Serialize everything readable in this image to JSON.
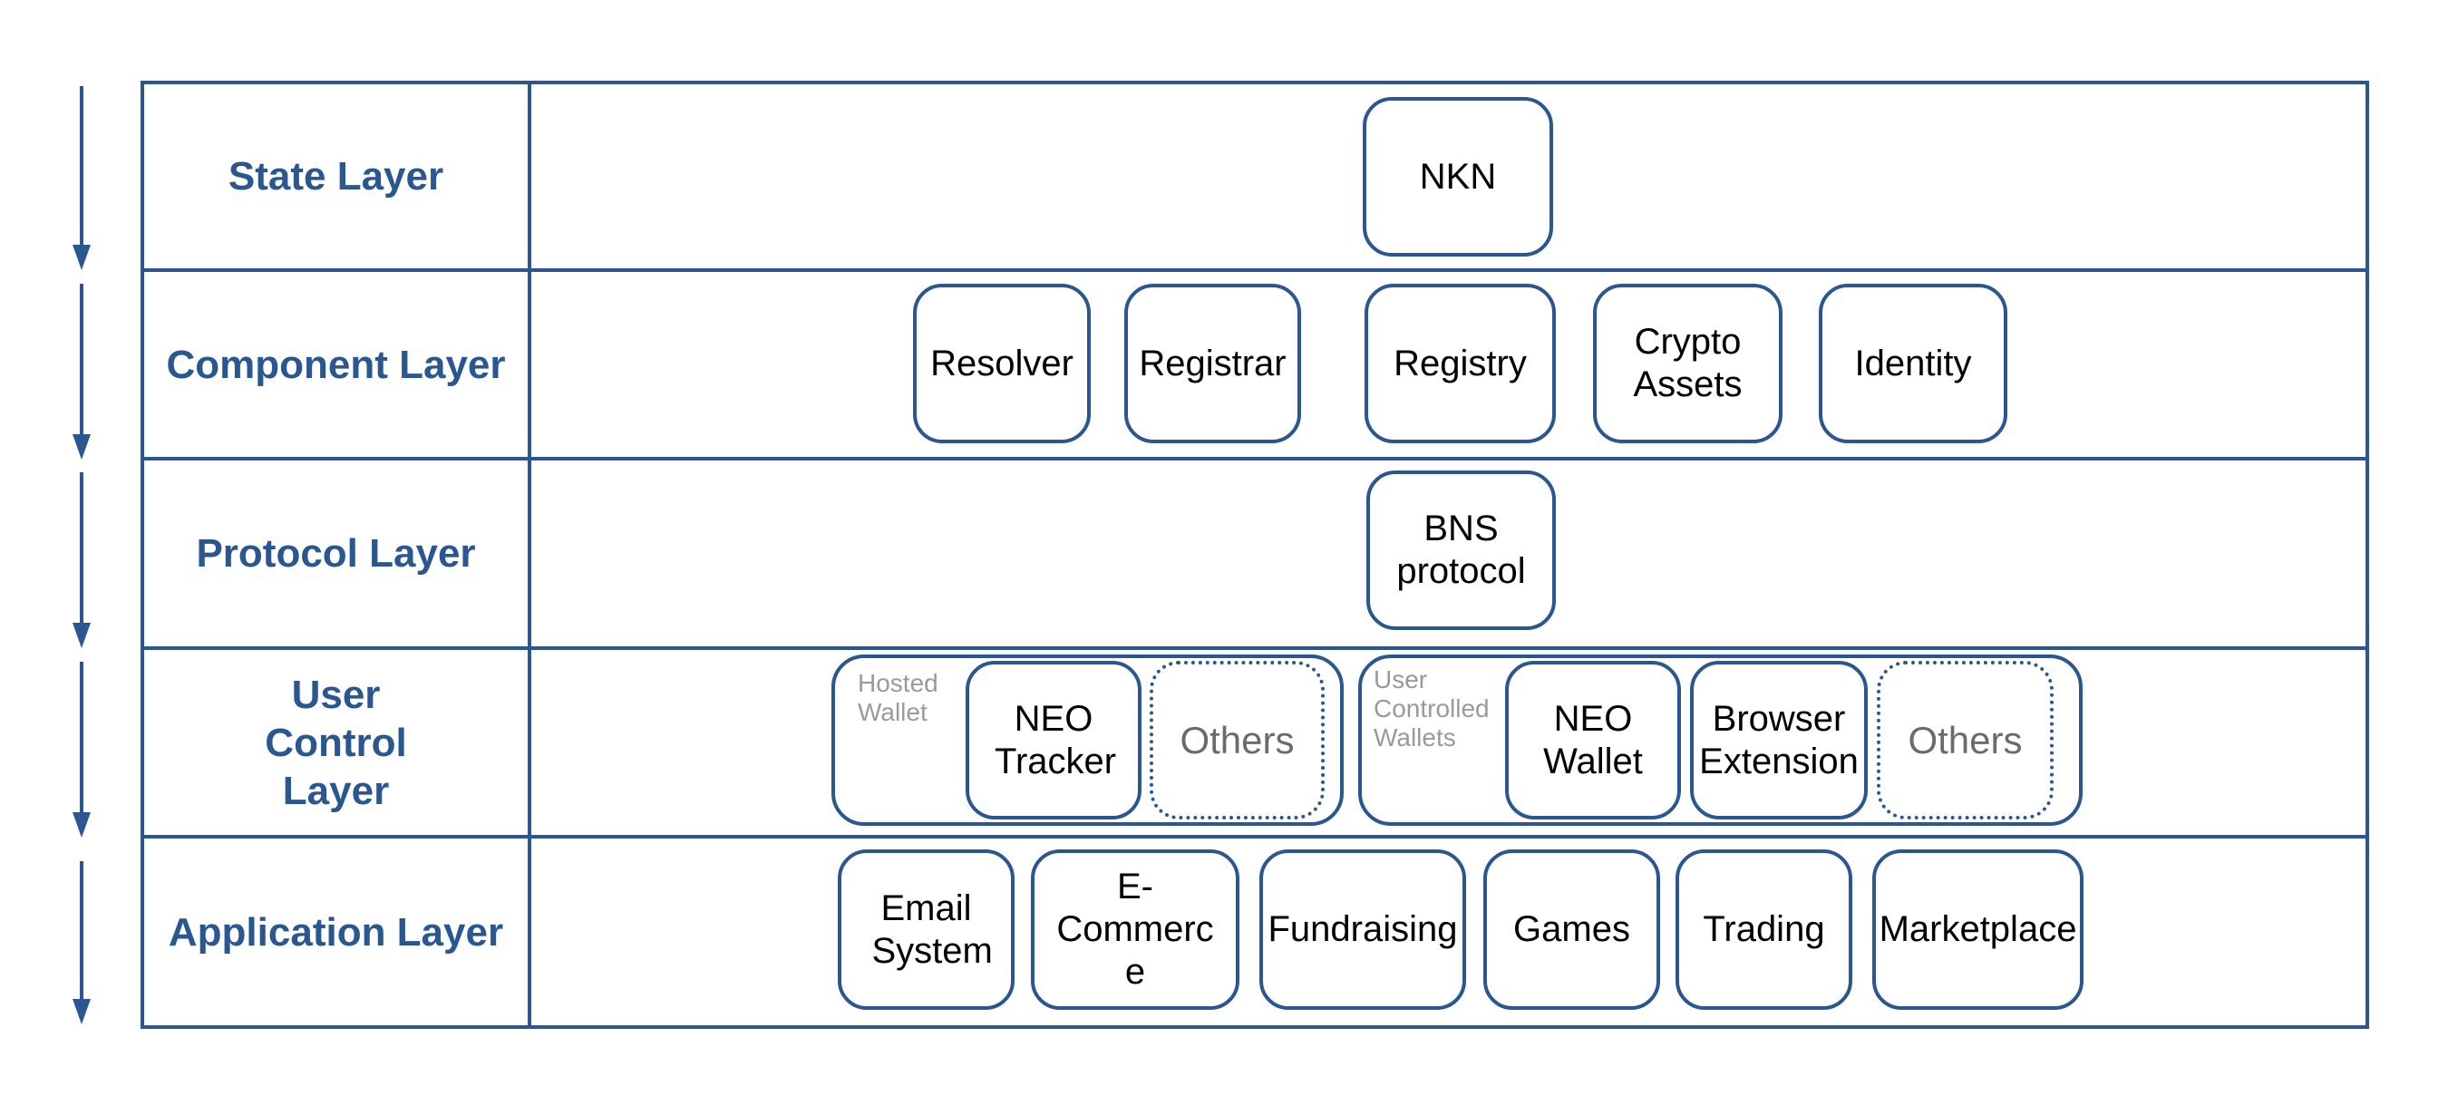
{
  "colors": {
    "accent": "#2a5791",
    "text": "#000000",
    "muted_text": "#9a9a9a",
    "placeholder_text": "#6b6b6b"
  },
  "layers": [
    {
      "label": "State Layer",
      "items": [
        {
          "label": "NKN"
        }
      ]
    },
    {
      "label": "Component Layer",
      "items": [
        {
          "label": "Resolver"
        },
        {
          "label": "Registrar"
        },
        {
          "label": "Registry"
        },
        {
          "label": "Crypto Assets"
        },
        {
          "label": "Identity"
        }
      ]
    },
    {
      "label": "Protocol Layer",
      "items": [
        {
          "label": "BNS protocol"
        }
      ]
    },
    {
      "label": "User Control Layer",
      "groups": [
        {
          "label": "Hosted Wallet",
          "items": [
            {
              "label": "NEO Tracker"
            },
            {
              "label": "Others",
              "placeholder": true
            }
          ]
        },
        {
          "label": "User Controlled Wallets",
          "items": [
            {
              "label": "NEO Wallet"
            },
            {
              "label": "Browser Extension"
            },
            {
              "label": "Others",
              "placeholder": true
            }
          ]
        }
      ]
    },
    {
      "label": "Application Layer",
      "items": [
        {
          "label": "Email System"
        },
        {
          "label": "E-Commerce"
        },
        {
          "label": "Fundraising"
        },
        {
          "label": "Games"
        },
        {
          "label": "Trading"
        },
        {
          "label": "Marketplace"
        }
      ]
    }
  ],
  "flow_direction": "top-to-bottom"
}
